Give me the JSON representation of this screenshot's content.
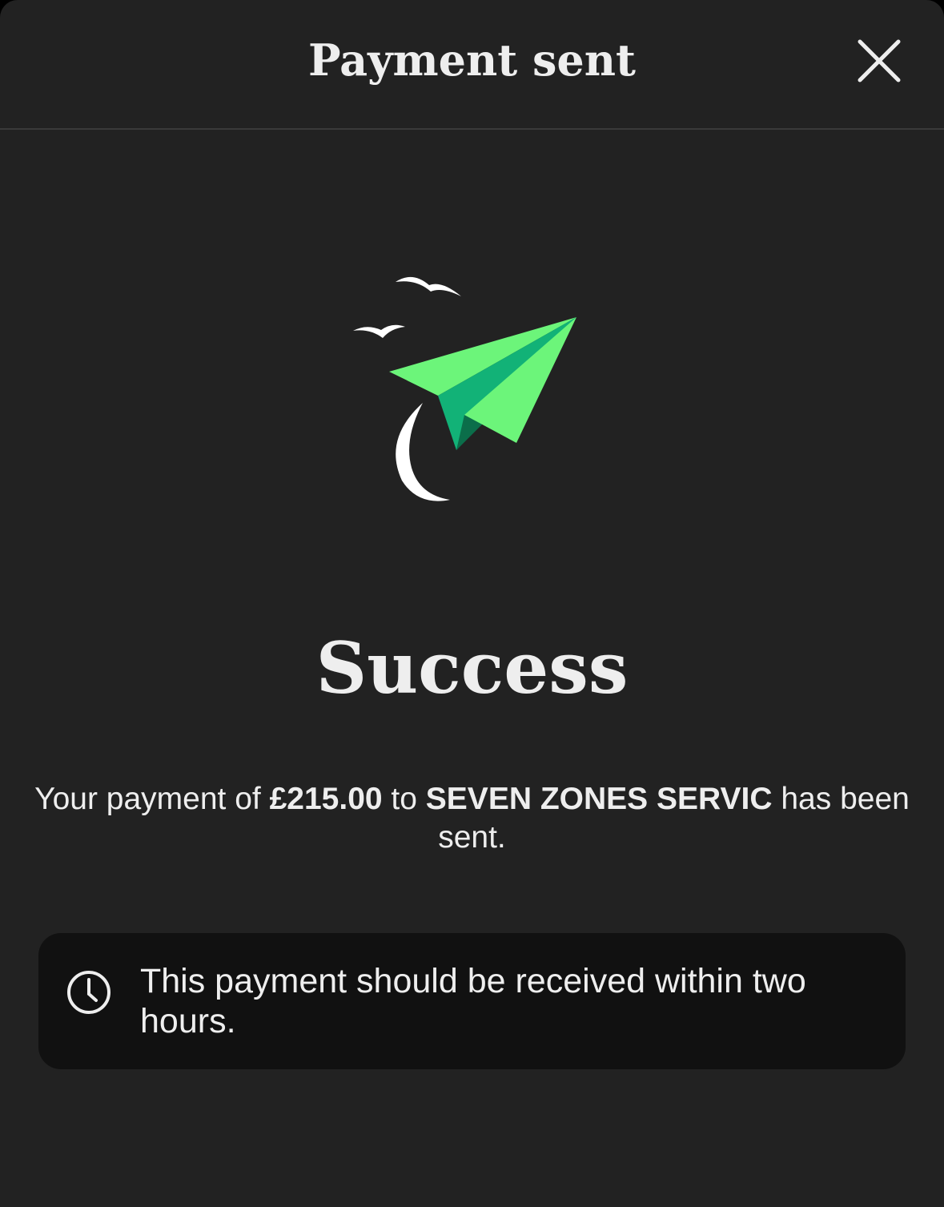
{
  "header": {
    "title": "Payment sent",
    "close_icon": "close-icon"
  },
  "illustration": {
    "icon": "paper-plane-icon",
    "plane_color_light": "#6cf57a",
    "plane_color_dark": "#12b277"
  },
  "result": {
    "title": "Success",
    "message_prefix": "Your payment of ",
    "amount": "£215.00",
    "message_middle": " to ",
    "payee": "SEVEN ZONES SERVIC",
    "message_suffix": " has been sent."
  },
  "notice": {
    "icon": "clock-icon",
    "text": "This payment should be received within two hours."
  },
  "colors": {
    "background": "#222222",
    "card": "#111111",
    "text": "#eeeeee",
    "divider": "#3a3a3a"
  }
}
